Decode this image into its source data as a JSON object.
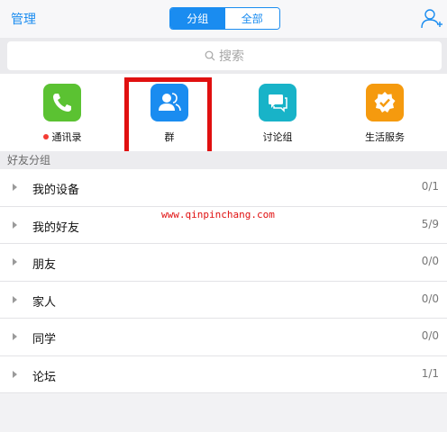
{
  "header": {
    "manage_label": "管理",
    "tabs": [
      {
        "label": "分组",
        "active": true
      },
      {
        "label": "全部",
        "active": false
      }
    ],
    "add_icon": "add-friend-icon"
  },
  "search": {
    "placeholder": "搜索",
    "icon": "search-icon"
  },
  "tiles": [
    {
      "label": "通讯录",
      "icon": "phone-icon",
      "color": "#5bc232",
      "badge_dot": true
    },
    {
      "label": "群",
      "icon": "group-icon",
      "color": "#1a8cf0",
      "badge_dot": false
    },
    {
      "label": "讨论组",
      "icon": "chat-icon",
      "color": "#18b3c8",
      "badge_dot": false
    },
    {
      "label": "生活服务",
      "icon": "service-icon",
      "color": "#f59a0e",
      "badge_dot": false
    }
  ],
  "section": {
    "title": "好友分组"
  },
  "groups": [
    {
      "name": "我的设备",
      "count": "0/1"
    },
    {
      "name": "我的好友",
      "count": "5/9"
    },
    {
      "name": "朋友",
      "count": "0/0"
    },
    {
      "name": "家人",
      "count": "0/0"
    },
    {
      "name": "同学",
      "count": "0/0"
    },
    {
      "name": "论坛",
      "count": "1/1"
    }
  ],
  "watermark": "www.qinpinchang.com",
  "colors": {
    "accent": "#1a8cf0",
    "highlight": "#e01010",
    "badge": "#f43b33"
  }
}
